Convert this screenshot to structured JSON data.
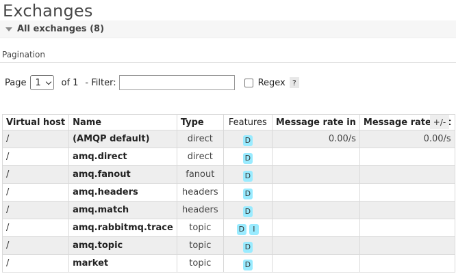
{
  "page": {
    "title": "Exchanges"
  },
  "section": {
    "label": "All exchanges (8)"
  },
  "pagination": {
    "title": "Pagination",
    "page_label": "Page",
    "page_value": "1",
    "of_text": "of 1",
    "filter_label": "- Filter:",
    "filter_value": "",
    "regex_label": "Regex",
    "help_label": "?"
  },
  "table": {
    "columns": [
      "Virtual host",
      "Name",
      "Type",
      "Features",
      "Message rate in",
      "Message rate out"
    ],
    "toggle_label": "+/-",
    "rows": [
      {
        "vhost": "/",
        "name": "(AMQP default)",
        "type": "direct",
        "features": [
          "D"
        ],
        "rate_in": "0.00/s",
        "rate_out": "0.00/s"
      },
      {
        "vhost": "/",
        "name": "amq.direct",
        "type": "direct",
        "features": [
          "D"
        ],
        "rate_in": "",
        "rate_out": ""
      },
      {
        "vhost": "/",
        "name": "amq.fanout",
        "type": "fanout",
        "features": [
          "D"
        ],
        "rate_in": "",
        "rate_out": ""
      },
      {
        "vhost": "/",
        "name": "amq.headers",
        "type": "headers",
        "features": [
          "D"
        ],
        "rate_in": "",
        "rate_out": ""
      },
      {
        "vhost": "/",
        "name": "amq.match",
        "type": "headers",
        "features": [
          "D"
        ],
        "rate_in": "",
        "rate_out": ""
      },
      {
        "vhost": "/",
        "name": "amq.rabbitmq.trace",
        "type": "topic",
        "features": [
          "D",
          "I"
        ],
        "rate_in": "",
        "rate_out": ""
      },
      {
        "vhost": "/",
        "name": "amq.topic",
        "type": "topic",
        "features": [
          "D"
        ],
        "rate_in": "",
        "rate_out": ""
      },
      {
        "vhost": "/",
        "name": "market",
        "type": "topic",
        "features": [
          "D"
        ],
        "rate_in": "",
        "rate_out": ""
      }
    ]
  },
  "colors": {
    "feature_badge": "#99ebff",
    "row_alt": "#eeeeee"
  }
}
